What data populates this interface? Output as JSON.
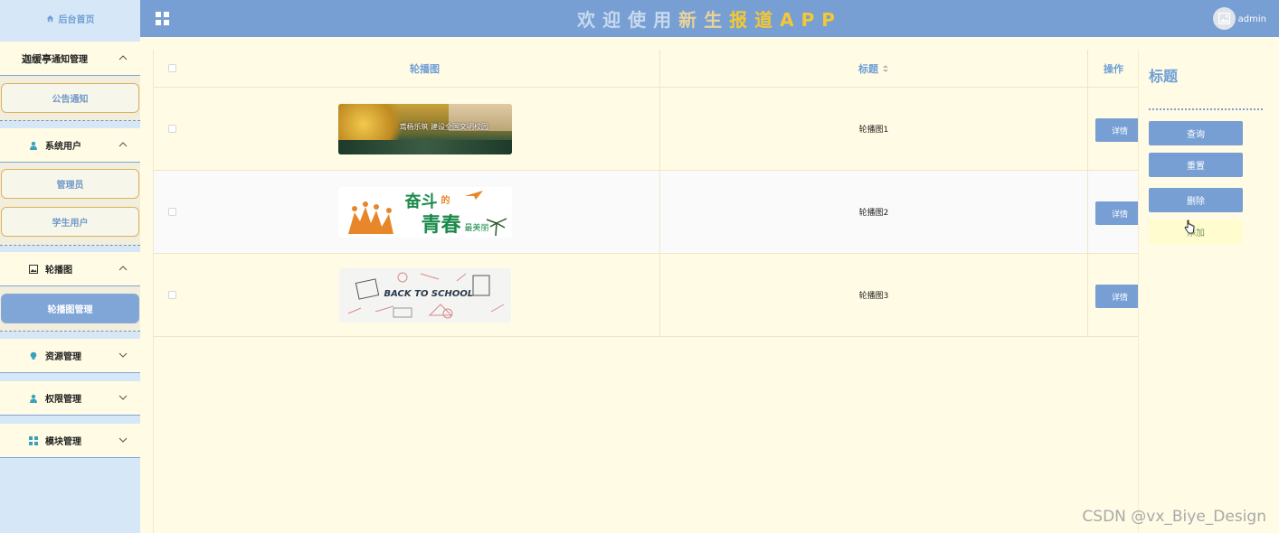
{
  "header": {
    "title_part1": "欢迎使用",
    "title_part2": "新生",
    "title_part3": "报道APP",
    "user": "admin"
  },
  "sidebar": {
    "home": "后台首页",
    "groups": [
      {
        "label": "通知管理",
        "prefix": "迦缓亭",
        "items": [
          "公告通知"
        ]
      },
      {
        "label": "系统用户",
        "items": [
          "管理员",
          "学生用户"
        ]
      },
      {
        "label": "轮播图",
        "items": [
          "轮播图管理"
        ]
      },
      {
        "label": "资源管理",
        "items": []
      },
      {
        "label": "权限管理",
        "items": []
      },
      {
        "label": "模块管理",
        "items": []
      }
    ]
  },
  "table": {
    "columns": [
      "轮播图",
      "标题",
      "操作"
    ],
    "rows": [
      {
        "title": "轮播图1",
        "action": "详情",
        "banner_text": "鸢杨乐筑 建设全国文明校园",
        "banner_theme": "autumn-campus"
      },
      {
        "title": "轮播图2",
        "action": "详情",
        "banner_text_a": "奋斗",
        "banner_text_b": "的",
        "banner_text_c": "青春",
        "banner_text_d": "最美丽",
        "banner_theme": "youth"
      },
      {
        "title": "轮播图3",
        "action": "详情",
        "banner_text": "BACK TO SCHOOL",
        "banner_theme": "back-to-school"
      }
    ]
  },
  "panel": {
    "title": "标题",
    "buttons": [
      "查询",
      "重置",
      "删除",
      "添加"
    ]
  },
  "watermark": "CSDN @vx_Biye_Design",
  "colors": {
    "accent": "#779fd3",
    "background": "#fffbe4",
    "sidebar": "#d6e7f7"
  }
}
